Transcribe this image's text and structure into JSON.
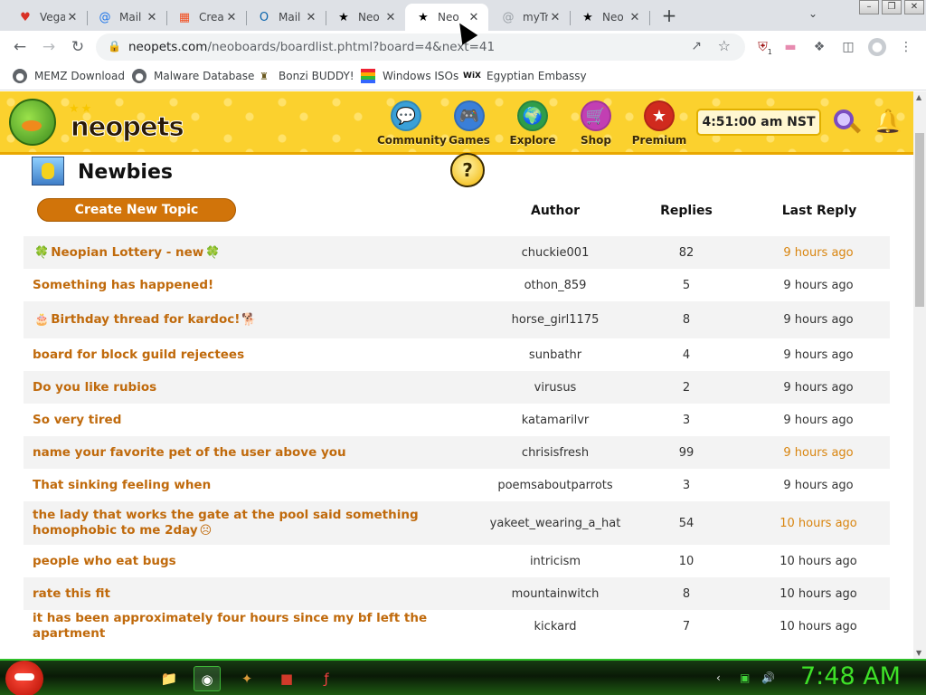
{
  "browser": {
    "tabs": [
      {
        "title": "Vega",
        "icon": "vivaldi-icon",
        "color": "#d93025"
      },
      {
        "title": "Mail",
        "icon": "at-mail-icon",
        "color": "#1a73e8"
      },
      {
        "title": "Crea",
        "icon": "microsoft-icon",
        "color": "#f25022"
      },
      {
        "title": "Mail",
        "icon": "outlook-icon",
        "color": "#0a64ad"
      },
      {
        "title": "Neo",
        "icon": "star-icon",
        "color": "#000000"
      },
      {
        "title": "Neo",
        "icon": "star-icon",
        "color": "#000000"
      },
      {
        "title": "myTr",
        "icon": "at-icon",
        "color": "#9aa0a6"
      },
      {
        "title": "Neo",
        "icon": "star-icon",
        "color": "#000000"
      }
    ],
    "active_tab_index": 5,
    "new_tab_symbol": "+",
    "url_host": "neopets.com",
    "url_path": "/neoboards/boardlist.phtml?board=4&next=41",
    "bookmarks": [
      {
        "label": "MEMZ Download"
      },
      {
        "label": "Malware Database"
      },
      {
        "label": "Bonzi BUDDY!"
      },
      {
        "label": "Windows ISOs"
      },
      {
        "label": "Egyptian Embassy"
      }
    ],
    "extension_badge": "1"
  },
  "nav": {
    "items": [
      {
        "label": "Community",
        "color": "#3aa0d8",
        "glyph": "💬"
      },
      {
        "label": "Games",
        "color": "#3a7fd8",
        "glyph": "🎮"
      },
      {
        "label": "Explore",
        "color": "#2e9d4a",
        "glyph": "🌍"
      },
      {
        "label": "Shop",
        "color": "#c23fb3",
        "glyph": "🛒"
      },
      {
        "label": "Premium",
        "color": "#d02a1e",
        "glyph": "★"
      }
    ],
    "clock": "4:51:00 am NST"
  },
  "board": {
    "title": "Newbies",
    "help_symbol": "?",
    "create_label": "Create New Topic",
    "headers": {
      "author": "Author",
      "replies": "Replies",
      "last_reply": "Last Reply"
    },
    "topics": [
      {
        "title": "Neopian Lottery - new",
        "pre": "🍀",
        "post": "🍀",
        "author": "chuckie001",
        "replies": "82",
        "last": "9 hours ago",
        "highlight": true
      },
      {
        "title": "Something has happened!",
        "pre": "",
        "post": "",
        "author": "othon_859",
        "replies": "5",
        "last": "9 hours ago",
        "highlight": false
      },
      {
        "title": "Birthday thread for kardoc!",
        "pre": "🎂",
        "post": "🐕",
        "author": "horse_girl1175",
        "replies": "8",
        "last": "9 hours ago",
        "highlight": false
      },
      {
        "title": "board for block guild rejectees",
        "pre": "",
        "post": "",
        "author": "sunbathr",
        "replies": "4",
        "last": "9 hours ago",
        "highlight": false
      },
      {
        "title": "Do you like rubios",
        "pre": "",
        "post": "",
        "author": "virusus",
        "replies": "2",
        "last": "9 hours ago",
        "highlight": false
      },
      {
        "title": "So very tired",
        "pre": "",
        "post": "",
        "author": "katamarilvr",
        "replies": "3",
        "last": "9 hours ago",
        "highlight": false
      },
      {
        "title": "name your favorite pet of the user above you",
        "pre": "",
        "post": "",
        "author": "chrisisfresh",
        "replies": "99",
        "last": "9 hours ago",
        "highlight": true
      },
      {
        "title": "That sinking feeling when",
        "pre": "",
        "post": "",
        "author": "poemsaboutparrots",
        "replies": "3",
        "last": "9 hours ago",
        "highlight": false
      },
      {
        "title": "the lady that works the gate at the pool said something homophobic to me 2day",
        "pre": "",
        "post": "☹",
        "author": "yakeet_wearing_a_hat",
        "replies": "54",
        "last": "10 hours ago",
        "highlight": true
      },
      {
        "title": "people who eat bugs",
        "pre": "",
        "post": "",
        "author": "intricism",
        "replies": "10",
        "last": "10 hours ago",
        "highlight": false
      },
      {
        "title": "rate this fit",
        "pre": "",
        "post": "",
        "author": "mountainwitch",
        "replies": "8",
        "last": "10 hours ago",
        "highlight": false
      },
      {
        "title": "it has been approximately four hours since my bf left the apartment",
        "pre": "",
        "post": "",
        "author": "kickard",
        "replies": "7",
        "last": "10 hours ago",
        "highlight": false
      }
    ]
  },
  "taskbar": {
    "clock": "7:48 AM"
  }
}
